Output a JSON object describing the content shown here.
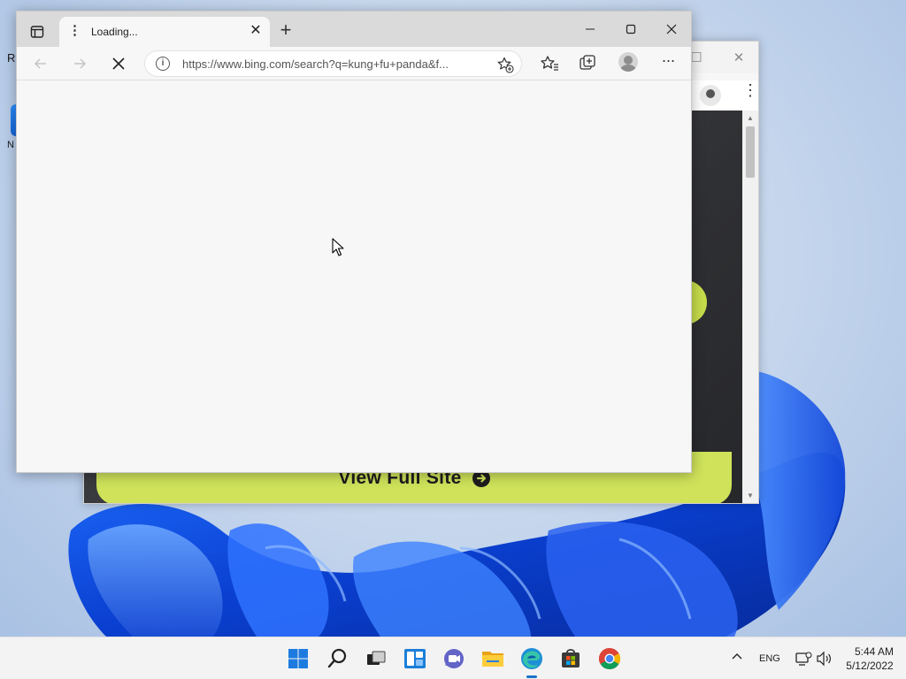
{
  "desktop": {
    "icon_label_fragment_1": "R",
    "icon_label_fragment_2": "N"
  },
  "back_window": {
    "full_site_label": "View Full Site",
    "accent_color": "#cfe25a"
  },
  "edge": {
    "tab": {
      "title": "Loading..."
    },
    "address": {
      "url": "https://www.bing.com/search?q=kung+fu+panda&f..."
    },
    "controls": {
      "minimize": "—",
      "maximize": "☐",
      "close": "✕"
    },
    "new_tab": "+",
    "more": "···"
  },
  "taskbar": {
    "language": "ENG",
    "time": "5:44 AM",
    "date": "5/12/2022",
    "apps": [
      "start-icon",
      "search-icon",
      "task-view-icon",
      "widgets-icon",
      "teams-chat-icon",
      "file-explorer-icon",
      "edge-icon",
      "store-icon",
      "chrome-icon"
    ]
  }
}
